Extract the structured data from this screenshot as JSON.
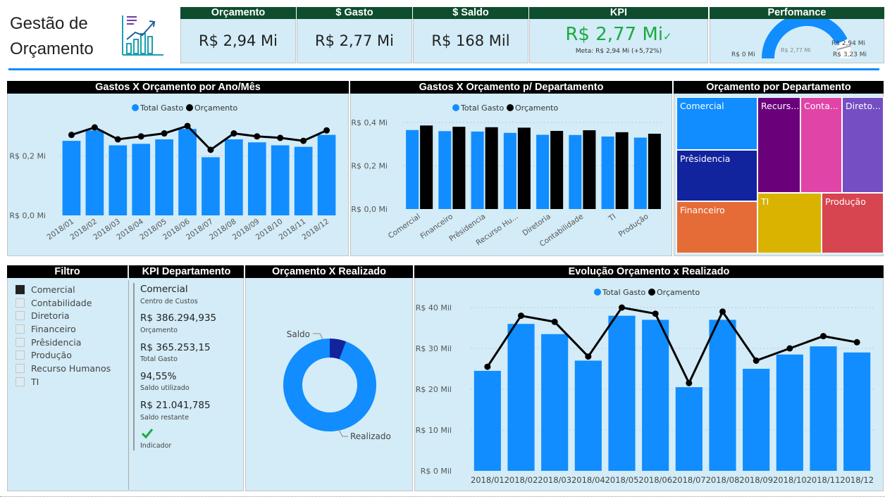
{
  "title": {
    "line1": "Gestão de",
    "line2": "Orçamento"
  },
  "kpis": [
    {
      "label": "Orçamento",
      "value": "R$ 2,94 Mi"
    },
    {
      "label": "$ Gasto",
      "value": "R$ 2,77 Mi"
    },
    {
      "label": "$ Saldo",
      "value": "R$ 168 Mil"
    }
  ],
  "kpi_card": {
    "label": "KPI",
    "value": "R$ 2,77 Mi",
    "check": "✓",
    "goal": "Meta: R$ 2,94 Mi (+5,72%)"
  },
  "performance": {
    "label": "Perfomance",
    "min": "R$ 0 Mi",
    "value": "R$ 2,77 Mi",
    "target": "R$ 2,94 Mi",
    "max": "R$ 3,23 Mi"
  },
  "panels": {
    "p1": "Gastos X Orçamento por Ano/Mês",
    "p2": "Gastos X Orçamento p/ Departamento",
    "p3": "Orçamento por Departamento",
    "p4": "Filtro",
    "p5": "KPI Departamento",
    "p6": "Orçamento X Realizado",
    "p7": "Evolução Orçamento x Realizado"
  },
  "legend": {
    "gasto": "Total Gasto",
    "orcamento": "Orçamento"
  },
  "colors": {
    "gasto": "#118dff",
    "orcamento": "#000000",
    "panel": "#d3ecf7",
    "header": "#000000",
    "kpi_header": "#0e4d2e",
    "kpi_green": "#1aab40",
    "accent_line": "#118dff"
  },
  "chart_data": [
    {
      "type": "bar",
      "title": "Gastos X Orçamento por Ano/Mês",
      "categories": [
        "2018/01",
        "2018/02",
        "2018/03",
        "2018/04",
        "2018/05",
        "2018/06",
        "2018/07",
        "2018/08",
        "2018/09",
        "2018/10",
        "2018/11",
        "2018/12"
      ],
      "series": [
        {
          "name": "Total Gasto",
          "type": "bar",
          "values": [
            0.25,
            0.285,
            0.235,
            0.24,
            0.255,
            0.29,
            0.195,
            0.255,
            0.245,
            0.235,
            0.23,
            0.27
          ]
        },
        {
          "name": "Orçamento",
          "type": "line",
          "values": [
            0.27,
            0.295,
            0.255,
            0.265,
            0.275,
            0.3,
            0.22,
            0.275,
            0.265,
            0.26,
            0.25,
            0.285
          ]
        }
      ],
      "yticks": [
        "R$ 0,0 Mi",
        "R$ 0,2 Mi"
      ],
      "ylim": [
        0,
        0.34
      ]
    },
    {
      "type": "bar",
      "title": "Gastos X Orçamento p/ Departamento",
      "categories": [
        "Comercial",
        "Financeiro",
        "Prêsidencia",
        "Recurso Hu...",
        "Diretoria",
        "Contabilidade",
        "TI",
        "Produção"
      ],
      "series": [
        {
          "name": "Total Gasto",
          "values": [
            0.365,
            0.36,
            0.358,
            0.352,
            0.343,
            0.342,
            0.335,
            0.33
          ]
        },
        {
          "name": "Orçamento",
          "values": [
            0.386,
            0.38,
            0.378,
            0.376,
            0.361,
            0.364,
            0.355,
            0.348
          ]
        }
      ],
      "yticks": [
        "R$ 0,0 Mi",
        "R$ 0,2 Mi",
        "R$ 0,4 Mi"
      ],
      "ylim": [
        0,
        0.4
      ]
    },
    {
      "type": "treemap",
      "title": "Orçamento por Departamento",
      "categories": [
        "Comercial",
        "Prêsidencia",
        "Financeiro",
        "Recurs...",
        "Conta...",
        "Direto...",
        "TI",
        "Produção"
      ]
    },
    {
      "type": "pie",
      "title": "Orçamento X Realizado",
      "categories": [
        "Saldo",
        "Realizado"
      ],
      "values": [
        168,
        2770
      ]
    },
    {
      "type": "bar",
      "title": "Evolução Orçamento x Realizado",
      "categories": [
        "2018/01",
        "2018/02",
        "2018/03",
        "2018/04",
        "2018/05",
        "2018/06",
        "2018/07",
        "2018/08",
        "2018/09",
        "2018/10",
        "2018/11",
        "2018/12"
      ],
      "series": [
        {
          "name": "Total Gasto",
          "type": "bar",
          "values": [
            24.5,
            36,
            33.5,
            27,
            38,
            37,
            20.5,
            37,
            25,
            28.5,
            30.5,
            29
          ]
        },
        {
          "name": "Orçamento",
          "type": "line",
          "values": [
            25.5,
            38,
            36.5,
            28,
            40,
            38.5,
            21.5,
            39,
            27,
            30,
            33,
            31.5
          ]
        }
      ],
      "yticks": [
        "R$ 0 Mil",
        "R$ 10 Mil",
        "R$ 20 Mil",
        "R$ 30 Mil",
        "R$ 40 Mil"
      ],
      "ylim": [
        0,
        40
      ]
    }
  ],
  "filter": {
    "items": [
      {
        "label": "Comercial",
        "checked": true
      },
      {
        "label": "Contabilidade",
        "checked": false
      },
      {
        "label": "Diretoria",
        "checked": false
      },
      {
        "label": "Financeiro",
        "checked": false
      },
      {
        "label": "Prêsidencia",
        "checked": false
      },
      {
        "label": "Produção",
        "checked": false
      },
      {
        "label": "Recurso Humanos",
        "checked": false
      },
      {
        "label": "TI",
        "checked": false
      }
    ]
  },
  "kpi_dept": {
    "name": "Comercial",
    "name_sub": "Centro de Custos",
    "orcamento": "R$ 386.294,935",
    "orcamento_label": "Orçamento",
    "gasto": "R$ 365.253,15",
    "gasto_label": "Total Gasto",
    "pct": "94,55%",
    "pct_label": "Saldo utilizado",
    "restante": "R$ 21.041,785",
    "restante_label": "Saldo restante",
    "indicador_label": "Indicador"
  }
}
